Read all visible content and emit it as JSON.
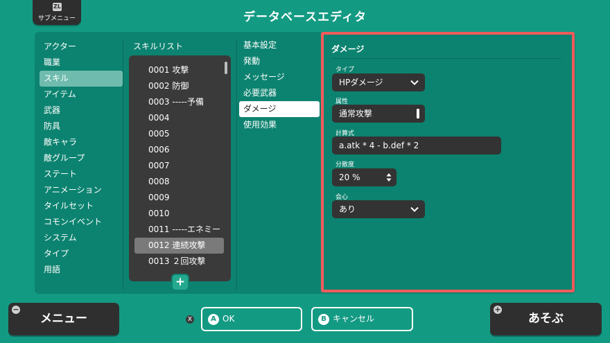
{
  "header": {
    "submenu_key": "ZL",
    "submenu_label": "サブメニュー",
    "title": "データベースエディタ"
  },
  "categories": {
    "items": [
      "アクター",
      "職業",
      "スキル",
      "アイテム",
      "武器",
      "防具",
      "敵キャラ",
      "敵グループ",
      "ステート",
      "アニメーション",
      "タイルセット",
      "コモンイベント",
      "システム",
      "タイプ",
      "用語"
    ],
    "selected": "スキル"
  },
  "skills": {
    "header": "スキルリスト",
    "items": [
      "0001 攻撃",
      "0002 防御",
      "0003 -----予備",
      "0004",
      "0005",
      "0006",
      "0007",
      "0008",
      "0009",
      "0010",
      "0011 -----エネミー",
      "0012 連続攻撃",
      "0013 ２回攻撃"
    ],
    "selected": "0012 連続攻撃",
    "add_label": "+"
  },
  "tabs": {
    "items": [
      "基本設定",
      "発動",
      "メッセージ",
      "必要武器",
      "ダメージ",
      "使用効果"
    ],
    "selected": "ダメージ"
  },
  "damage": {
    "title": "ダメージ",
    "type_label": "タイプ",
    "type_value": "HPダメージ",
    "element_label": "属性",
    "element_value": "通常攻撃",
    "formula_label": "計算式",
    "formula_value": "a.atk * 4 - b.def * 2",
    "variance_label": "分散度",
    "variance_value": "20 %",
    "critical_label": "会心",
    "critical_value": "あり"
  },
  "footer": {
    "menu_label": "メニュー",
    "x_key": "X",
    "ok_key": "A",
    "ok_label": "OK",
    "cancel_key": "B",
    "cancel_label": "キャンセル",
    "play_label": "あそぶ"
  },
  "colors": {
    "background": "#139a83",
    "panel": "#0c8370",
    "highlight_border": "#f15b5b",
    "field": "#333333"
  }
}
